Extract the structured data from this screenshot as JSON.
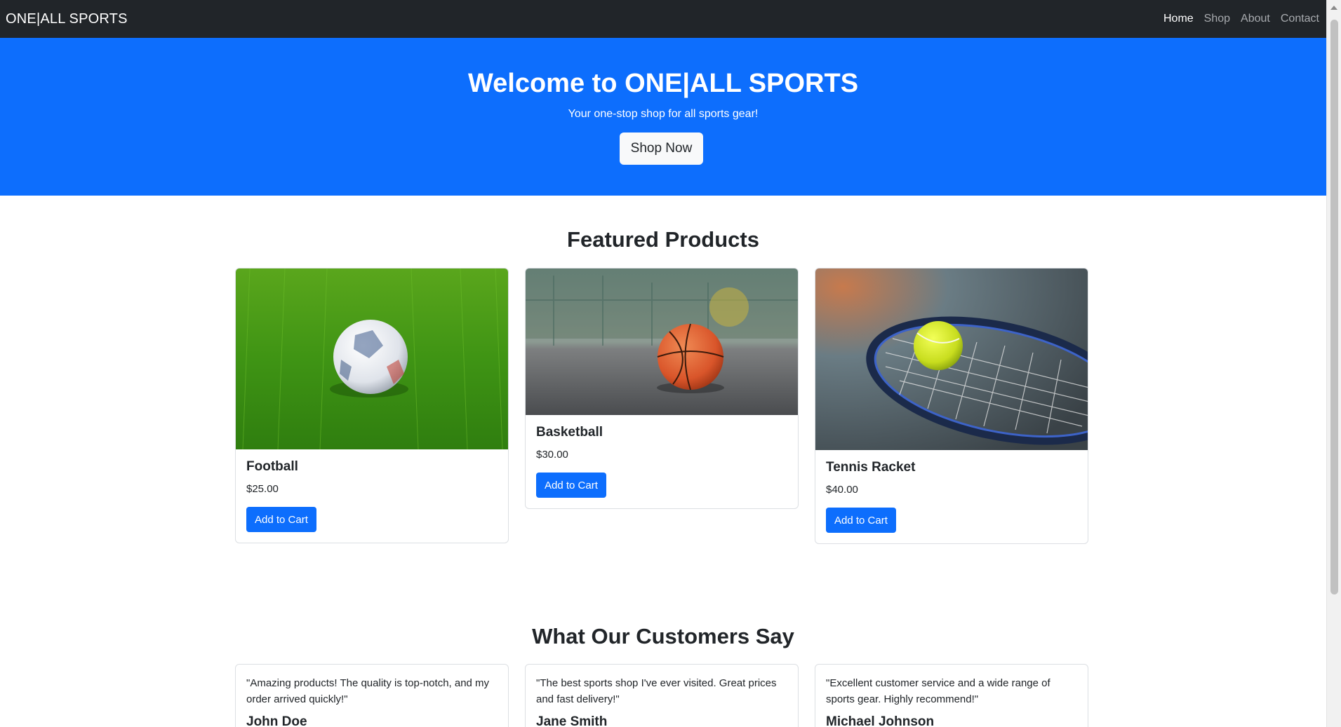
{
  "navbar": {
    "brand": "ONE|ALL SPORTS",
    "links": [
      {
        "label": "Home",
        "active": true
      },
      {
        "label": "Shop",
        "active": false
      },
      {
        "label": "About",
        "active": false
      },
      {
        "label": "Contact",
        "active": false
      }
    ]
  },
  "hero": {
    "title": "Welcome to ONE|ALL SPORTS",
    "subtitle": "Your one-stop shop for all sports gear!",
    "cta_label": "Shop Now",
    "background_color": "#0d6efd"
  },
  "featured": {
    "title": "Featured Products",
    "products": [
      {
        "name": "Football",
        "price": "$25.00",
        "button_label": "Add to Cart",
        "image": "soccer-ball-on-grass"
      },
      {
        "name": "Basketball",
        "price": "$30.00",
        "button_label": "Add to Cart",
        "image": "basketball-on-court"
      },
      {
        "name": "Tennis Racket",
        "price": "$40.00",
        "button_label": "Add to Cart",
        "image": "tennis-ball-on-racket"
      }
    ]
  },
  "testimonials": {
    "title": "What Our Customers Say",
    "items": [
      {
        "quote": "\"Amazing products! The quality is top-notch, and my order arrived quickly!\"",
        "name": "John Doe"
      },
      {
        "quote": "\"The best sports shop I've ever visited. Great prices and fast delivery!\"",
        "name": "Jane Smith"
      },
      {
        "quote": "\"Excellent customer service and a wide range of sports gear. Highly recommend!\"",
        "name": "Michael Johnson"
      }
    ]
  },
  "colors": {
    "navbar": "#212529",
    "primary": "#0d6efd",
    "button_light": "#f8f9fa"
  }
}
